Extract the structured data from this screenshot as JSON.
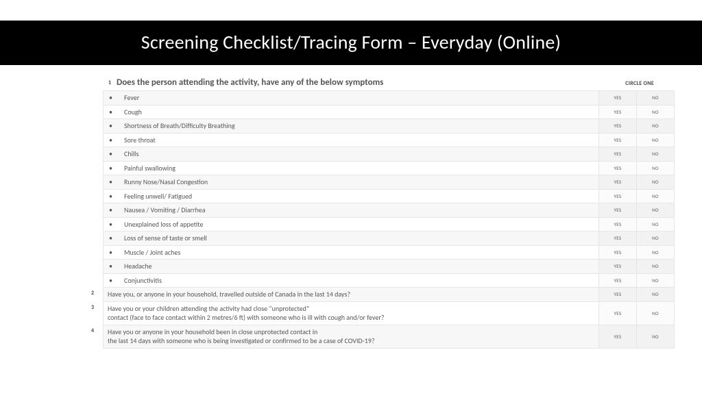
{
  "header": {
    "title": "Screening Checklist/Tracing Form – Everyday (Online)"
  },
  "labels": {
    "circle_one": "CIRCLE ONE",
    "yes": "YES",
    "no": "NO"
  },
  "q1": {
    "num": "1",
    "text": "Does the person attending the activity, have any of the below symptoms",
    "symptoms": [
      "Fever",
      "Cough",
      "Shortness of Breath/Difficulty Breathing",
      "Sore throat",
      "Chills",
      "Painful swallowing",
      "Runny Nose/Nasal Congestion",
      "Feeling unwell/ Fatigued",
      "Nausea / Vomiting / Diarrhea",
      "Unexplained loss of appetite",
      "Loss of sense of taste or smell",
      "Muscle / Joint aches",
      "Headache",
      "Conjunctivitis"
    ]
  },
  "questions": [
    {
      "num": "2",
      "line1": "Have you, or anyone in your household, travelled outside of Canada in the last 14 days?",
      "line2": ""
    },
    {
      "num": "3",
      "line1": "Have you or your children attending the activity had close “unprotected”",
      "line2": "contact (face to face contact within 2 metres/6 ft) with someone who is ill with cough and/or fever?"
    },
    {
      "num": "4",
      "line1": "Have you or anyone in your household been in close unprotected contact in",
      "line2": "the last 14 days with someone who is being investigated or confirmed to be a case of COVID-19?"
    }
  ]
}
